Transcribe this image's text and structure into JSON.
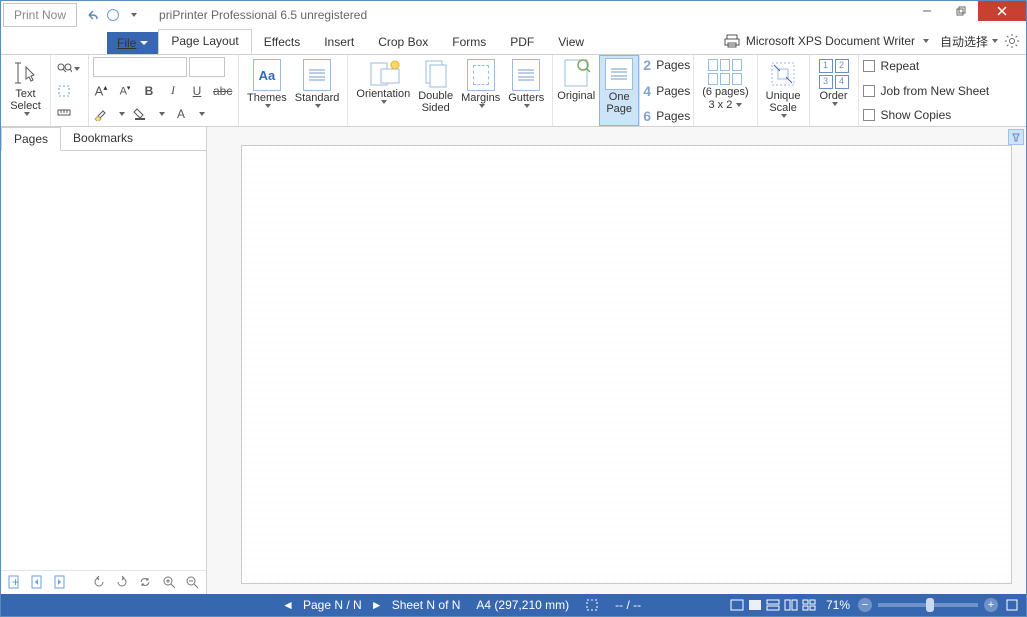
{
  "title": "priPrinter Professional 6.5 unregistered",
  "print_now": "Print Now",
  "tabs": {
    "file": "File",
    "page_layout": "Page Layout",
    "effects": "Effects",
    "insert": "Insert",
    "crop_box": "Crop Box",
    "forms": "Forms",
    "pdf": "PDF",
    "view": "View"
  },
  "printer": {
    "name": "Microsoft XPS Document Writer",
    "auto": "自动选择"
  },
  "ribbon": {
    "text_select": "Text\nSelect",
    "themes": "Themes",
    "standard": "Standard",
    "orientation": "Orientation",
    "double_sided": "Double\nSided",
    "margins": "Margins",
    "gutters": "Gutters",
    "original": "Original",
    "one_page": "One\nPage",
    "pages2": "Pages",
    "pages4": "Pages",
    "pages6": "Pages",
    "n2": "2",
    "n4": "4",
    "n6": "6",
    "six_pages": "(6 pages)",
    "grid": "3 x 2",
    "unique_scale": "Unique\nScale",
    "order": "Order",
    "repeat": "Repeat",
    "job_new": "Job from New Sheet",
    "show_copies": "Show Copies"
  },
  "side": {
    "pages": "Pages",
    "bookmarks": "Bookmarks"
  },
  "status": {
    "page": "Page N / N",
    "sheet": "Sheet N of N",
    "paper": "A4 (297,210 mm)",
    "sel": "-- / --",
    "zoom": "71%"
  }
}
